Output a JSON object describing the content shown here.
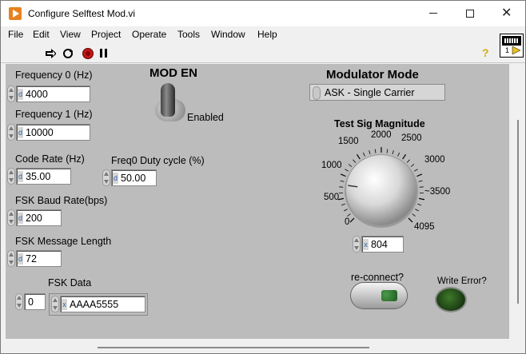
{
  "window": {
    "title": "Configure Selftest Mod.vi"
  },
  "menu": [
    "File",
    "Edit",
    "View",
    "Project",
    "Operate",
    "Tools",
    "Window",
    "Help"
  ],
  "vi_icon": {
    "number": "1"
  },
  "controls": {
    "freq0": {
      "label": "Frequency 0 (Hz)",
      "radix": "d",
      "value": "4000"
    },
    "freq1": {
      "label": "Frequency 1 (Hz)",
      "radix": "d",
      "value": "10000"
    },
    "code_rate": {
      "label": "Code Rate (Hz)",
      "radix": "d",
      "value": "35.00"
    },
    "freq0_duty": {
      "label": "Freq0 Duty cycle (%)",
      "radix": "d",
      "value": "50.00"
    },
    "fsk_baud": {
      "label": "FSK Baud Rate(bps)",
      "radix": "d",
      "value": "200"
    },
    "fsk_msg_len": {
      "label": "FSK Message Length",
      "radix": "d",
      "value": "72"
    },
    "fsk_data": {
      "label": "FSK Data",
      "index": "0",
      "radix": "x",
      "value": "AAAA5555"
    },
    "mod_en": {
      "label": "MOD EN",
      "state_label": "Enabled"
    },
    "modulator_mode": {
      "label": "Modulator Mode",
      "value": "ASK - Single Carrier"
    },
    "test_sig_magnitude": {
      "label": "Test Sig Magnitude",
      "ticks": [
        "0",
        "500",
        "1000",
        "1500",
        "2000",
        "2500",
        "3000",
        "~3500",
        "4095"
      ],
      "radix": "x",
      "value": "804",
      "min": 0,
      "max": 4095
    },
    "reconnect": {
      "label": "re-connect?"
    },
    "write_error": {
      "label": "Write Error?",
      "state": false
    }
  },
  "colors": {
    "panel": "#bcbcbc",
    "led_off": "#2a5a1e",
    "window_icon": "#e8821e"
  }
}
